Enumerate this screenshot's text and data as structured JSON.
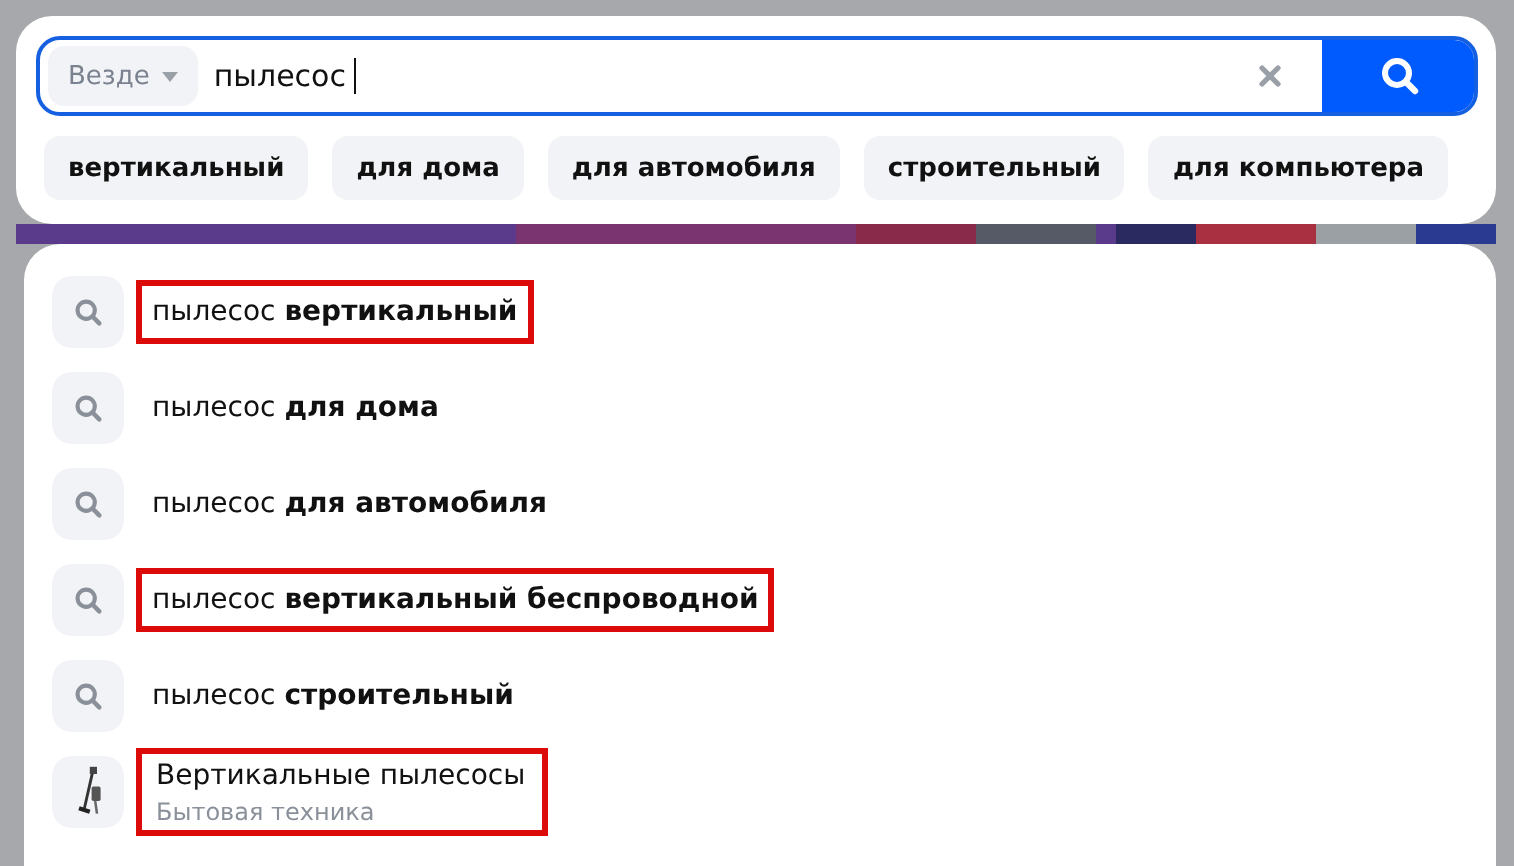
{
  "search": {
    "scope": "Везде",
    "value": "пылесос",
    "focused": true
  },
  "chips": [
    "вертикальный",
    "для дома",
    "для автомобиля",
    "строительный",
    "для компьютера"
  ],
  "suggestions": [
    {
      "kind": "query",
      "text": "пылесос **вертикальный**",
      "highlighted": true
    },
    {
      "kind": "query",
      "text": "пылесос **для дома**",
      "highlighted": false
    },
    {
      "kind": "query",
      "text": "пылесос **для автомобиля**",
      "highlighted": false
    },
    {
      "kind": "query",
      "text": "пылесос **вертикальный беспроводной**",
      "highlighted": true
    },
    {
      "kind": "query",
      "text": "пылесос **строительный**",
      "highlighted": false
    },
    {
      "kind": "category",
      "text": "Вертикальные пылесосы",
      "subtitle": "Бытовая техника",
      "highlighted": true
    }
  ]
}
